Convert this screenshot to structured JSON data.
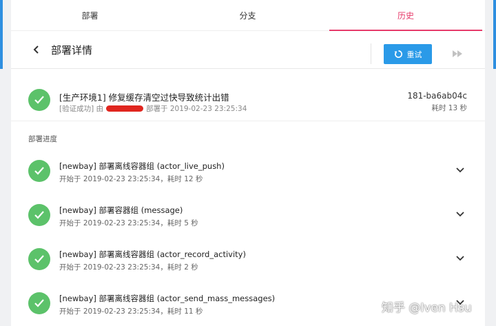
{
  "tabs": [
    {
      "label": "部署"
    },
    {
      "label": "分支"
    },
    {
      "label": "历史",
      "active": true
    }
  ],
  "header": {
    "back_icon": "chevron-left-icon",
    "title": "部署详情",
    "retry_label": "重试",
    "retry_icon": "refresh-icon",
    "more_icon": "fast-forward-icon"
  },
  "summary": {
    "status_icon": "check-circle-icon",
    "title": "[生产环境1] 修复缓存清空过快导致统计出错",
    "sub_prefix": "[验证成功] 由",
    "sub_suffix": "部署于 2019-02-23 23:25:34",
    "hash": "181-ba6ab04c",
    "duration": "耗时 13 秒"
  },
  "section_label": "部署进度",
  "steps": [
    {
      "title": "[newbay] 部署离线容器组 (actor_live_push)",
      "sub": "开始于 2019-02-23 23:25:34，耗时 12 秒"
    },
    {
      "title": "[newbay] 部署容器组 (message)",
      "sub": "开始于 2019-02-23 23:25:34，耗时 5 秒"
    },
    {
      "title": "[newbay] 部署离线容器组 (actor_record_activity)",
      "sub": "开始于 2019-02-23 23:25:34，耗时 2 秒"
    },
    {
      "title": "[newbay] 部署离线容器组 (actor_send_mass_messages)",
      "sub": "开始于 2019-02-23 23:25:34，耗时 11 秒"
    }
  ],
  "watermark": "知乎 @Iven Hsu",
  "colors": {
    "accent": "#2a9ae8",
    "active_tab": "#e63a6a",
    "success": "#5cc26a",
    "redaction": "#e0261f"
  }
}
